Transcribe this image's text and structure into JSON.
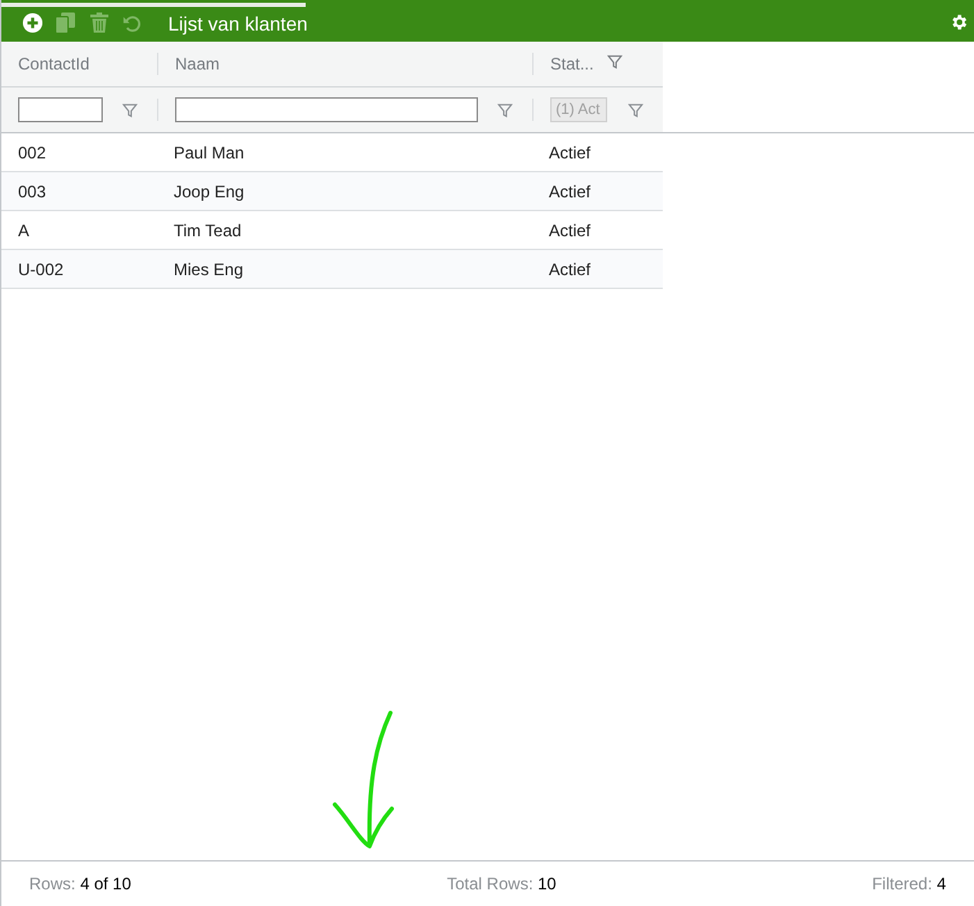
{
  "toolbar": {
    "buttons": [
      {
        "kind": "add",
        "disabled": false
      },
      {
        "kind": "copy",
        "disabled": true
      },
      {
        "kind": "delete",
        "disabled": true
      },
      {
        "kind": "undo",
        "disabled": true
      }
    ],
    "title": "Lijst van klanten"
  },
  "table": {
    "columns": [
      {
        "label": "ContactId",
        "filter_icon": false,
        "filter_disabled": false
      },
      {
        "label": "Naam",
        "filter_icon": false,
        "filter_disabled": false
      },
      {
        "label": "Stat...",
        "filter_icon": true,
        "filter_value": "(1) Act",
        "filter_disabled": true
      }
    ],
    "rows": [
      [
        "002",
        "Paul Man",
        "Actief"
      ],
      [
        "003",
        "Joop Eng",
        "Actief"
      ],
      [
        "A",
        "Tim Tead",
        "Actief"
      ],
      [
        "U-002",
        "Mies Eng",
        "Actief"
      ]
    ]
  },
  "status_bar": [
    {
      "label": "Rows:",
      "value": "4 of 10"
    },
    {
      "label": "Total Rows:",
      "value": "10"
    },
    {
      "label": "Filtered:",
      "value": "4"
    }
  ]
}
